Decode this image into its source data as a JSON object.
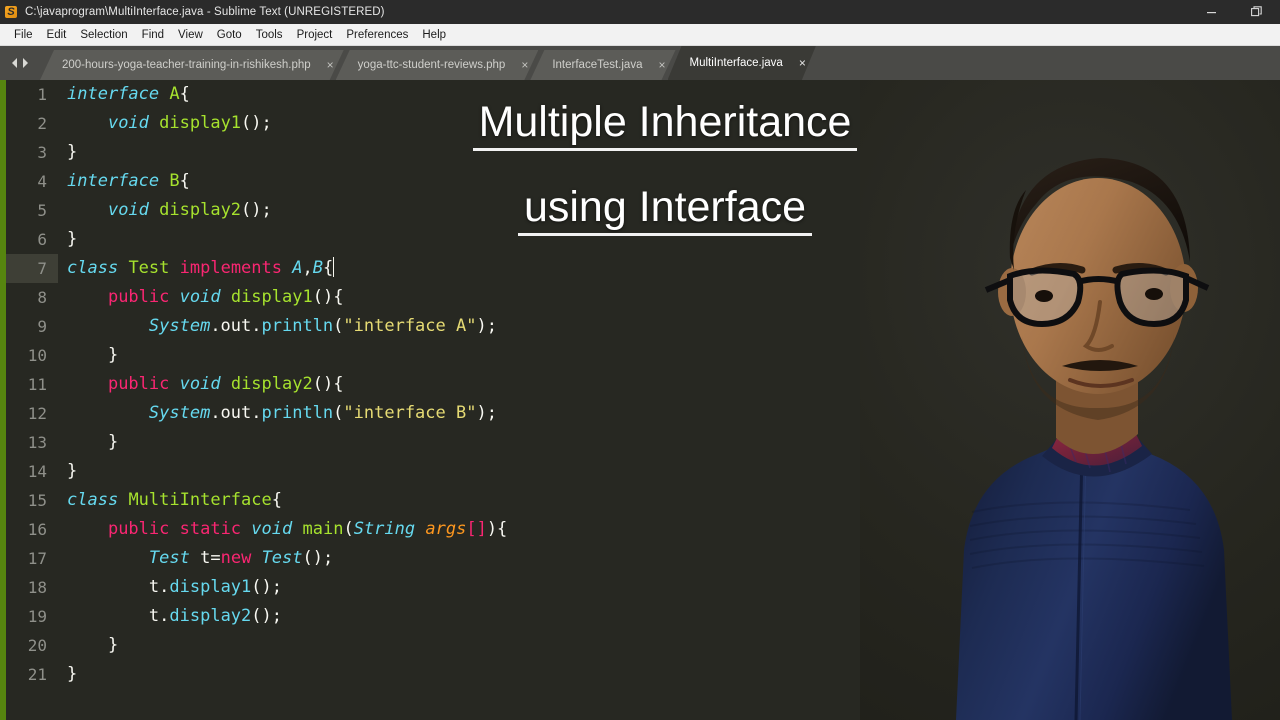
{
  "window": {
    "app_icon": "sublime-text-icon",
    "icon_glyph": "S",
    "title": "C:\\javaprogram\\MultiInterface.java - Sublime Text (UNREGISTERED)",
    "controls": [
      {
        "name": "minimize-button",
        "glyph": "minimize-icon"
      },
      {
        "name": "restore-button",
        "glyph": "restore-icon"
      }
    ]
  },
  "menubar": {
    "items": [
      {
        "label": "File"
      },
      {
        "label": "Edit"
      },
      {
        "label": "Selection"
      },
      {
        "label": "Find"
      },
      {
        "label": "View"
      },
      {
        "label": "Goto"
      },
      {
        "label": "Tools"
      },
      {
        "label": "Project"
      },
      {
        "label": "Preferences"
      },
      {
        "label": "Help"
      }
    ]
  },
  "tabbar": {
    "nav_prev_icon": "chevron-left-icon",
    "nav_next_icon": "chevron-right-icon",
    "close_glyph": "×",
    "tabs": [
      {
        "label": "200-hours-yoga-teacher-training-in-rishikesh.php",
        "active": false
      },
      {
        "label": "yoga-ttc-student-reviews.php",
        "active": false
      },
      {
        "label": "InterfaceTest.java",
        "active": false
      },
      {
        "label": "MultiInterface.java",
        "active": true
      }
    ]
  },
  "overlay": {
    "line1": "Multiple  Inheritance",
    "line2": "using  Interface"
  },
  "editor": {
    "language": "Java",
    "file_name": "MultiInterface.java",
    "current_line": 7,
    "theme_colors": {
      "background": "#272822",
      "gutter_text": "#8f908a",
      "foreground": "#f8f8f2",
      "keyword": "#66d9ef",
      "modifier": "#f92672",
      "type_name": "#a6e22e",
      "string": "#e6db74",
      "parameter": "#fd971f",
      "edge_stripe": "#56850f",
      "current_line_gutter": "#3e3f36"
    },
    "lines": [
      {
        "n": 1,
        "text": "interface A{"
      },
      {
        "n": 2,
        "text": "    void display1();"
      },
      {
        "n": 3,
        "text": "}"
      },
      {
        "n": 4,
        "text": "interface B{"
      },
      {
        "n": 5,
        "text": "    void display2();"
      },
      {
        "n": 6,
        "text": "}"
      },
      {
        "n": 7,
        "text": "class Test implements A,B{"
      },
      {
        "n": 8,
        "text": "    public void display1(){"
      },
      {
        "n": 9,
        "text": "        System.out.println(\"interface A\");"
      },
      {
        "n": 10,
        "text": "    }"
      },
      {
        "n": 11,
        "text": "    public void display2(){"
      },
      {
        "n": 12,
        "text": "        System.out.println(\"interface B\");"
      },
      {
        "n": 13,
        "text": "    }"
      },
      {
        "n": 14,
        "text": "}"
      },
      {
        "n": 15,
        "text": "class MultiInterface{"
      },
      {
        "n": 16,
        "text": "    public static void main(String args[]){"
      },
      {
        "n": 17,
        "text": "        Test t=new Test();"
      },
      {
        "n": 18,
        "text": "        t.display1();"
      },
      {
        "n": 19,
        "text": "        t.display2();"
      },
      {
        "n": 20,
        "text": "    }"
      },
      {
        "n": 21,
        "text": "}"
      }
    ]
  },
  "minimap": {
    "name": "code-minimap",
    "rows": [
      [
        {
          "w": 14,
          "c": "#66d9ef"
        },
        {
          "w": 6,
          "c": "#a6e22e"
        }
      ],
      [
        {
          "w": 6,
          "c": "#272822"
        },
        {
          "w": 10,
          "c": "#66d9ef"
        },
        {
          "w": 14,
          "c": "#a6e22e"
        }
      ],
      [
        {
          "w": 4,
          "c": "#f8f8f2"
        }
      ],
      [
        {
          "w": 14,
          "c": "#66d9ef"
        },
        {
          "w": 6,
          "c": "#a6e22e"
        }
      ],
      [
        {
          "w": 6,
          "c": "#272822"
        },
        {
          "w": 10,
          "c": "#66d9ef"
        },
        {
          "w": 14,
          "c": "#a6e22e"
        }
      ],
      [
        {
          "w": 4,
          "c": "#f8f8f2"
        }
      ],
      [
        {
          "w": 12,
          "c": "#66d9ef"
        },
        {
          "w": 10,
          "c": "#a6e22e"
        },
        {
          "w": 18,
          "c": "#f92672"
        }
      ],
      [
        {
          "w": 6,
          "c": "#272822"
        },
        {
          "w": 12,
          "c": "#f92672"
        },
        {
          "w": 8,
          "c": "#66d9ef"
        },
        {
          "w": 16,
          "c": "#a6e22e"
        }
      ],
      [
        {
          "w": 12,
          "c": "#272822"
        },
        {
          "w": 10,
          "c": "#66d9ef"
        },
        {
          "w": 8,
          "c": "#f8f8f2"
        },
        {
          "w": 12,
          "c": "#66d9ef"
        },
        {
          "w": 14,
          "c": "#e6db74"
        }
      ],
      [
        {
          "w": 6,
          "c": "#f8f8f2"
        }
      ],
      [
        {
          "w": 6,
          "c": "#272822"
        },
        {
          "w": 12,
          "c": "#f92672"
        },
        {
          "w": 8,
          "c": "#66d9ef"
        },
        {
          "w": 16,
          "c": "#a6e22e"
        }
      ],
      [
        {
          "w": 12,
          "c": "#272822"
        },
        {
          "w": 10,
          "c": "#66d9ef"
        },
        {
          "w": 8,
          "c": "#f8f8f2"
        },
        {
          "w": 12,
          "c": "#66d9ef"
        },
        {
          "w": 14,
          "c": "#e6db74"
        }
      ],
      [
        {
          "w": 6,
          "c": "#f8f8f2"
        }
      ],
      [
        {
          "w": 4,
          "c": "#f8f8f2"
        }
      ],
      [
        {
          "w": 12,
          "c": "#66d9ef"
        },
        {
          "w": 20,
          "c": "#a6e22e"
        }
      ],
      [
        {
          "w": 6,
          "c": "#272822"
        },
        {
          "w": 10,
          "c": "#f92672"
        },
        {
          "w": 10,
          "c": "#f92672"
        },
        {
          "w": 8,
          "c": "#66d9ef"
        },
        {
          "w": 10,
          "c": "#a6e22e"
        },
        {
          "w": 8,
          "c": "#fd971f"
        }
      ],
      [
        {
          "w": 12,
          "c": "#272822"
        },
        {
          "w": 8,
          "c": "#66d9ef"
        },
        {
          "w": 6,
          "c": "#f92672"
        },
        {
          "w": 8,
          "c": "#66d9ef"
        }
      ],
      [
        {
          "w": 12,
          "c": "#272822"
        },
        {
          "w": 14,
          "c": "#f8f8f2"
        }
      ],
      [
        {
          "w": 12,
          "c": "#272822"
        },
        {
          "w": 14,
          "c": "#f8f8f2"
        }
      ],
      [
        {
          "w": 8,
          "c": "#f8f8f2"
        }
      ],
      [
        {
          "w": 4,
          "c": "#f8f8f2"
        }
      ]
    ]
  },
  "person": {
    "name": "presenter-video-overlay",
    "description": "presenter with glasses wearing navy blue zip jacket"
  }
}
